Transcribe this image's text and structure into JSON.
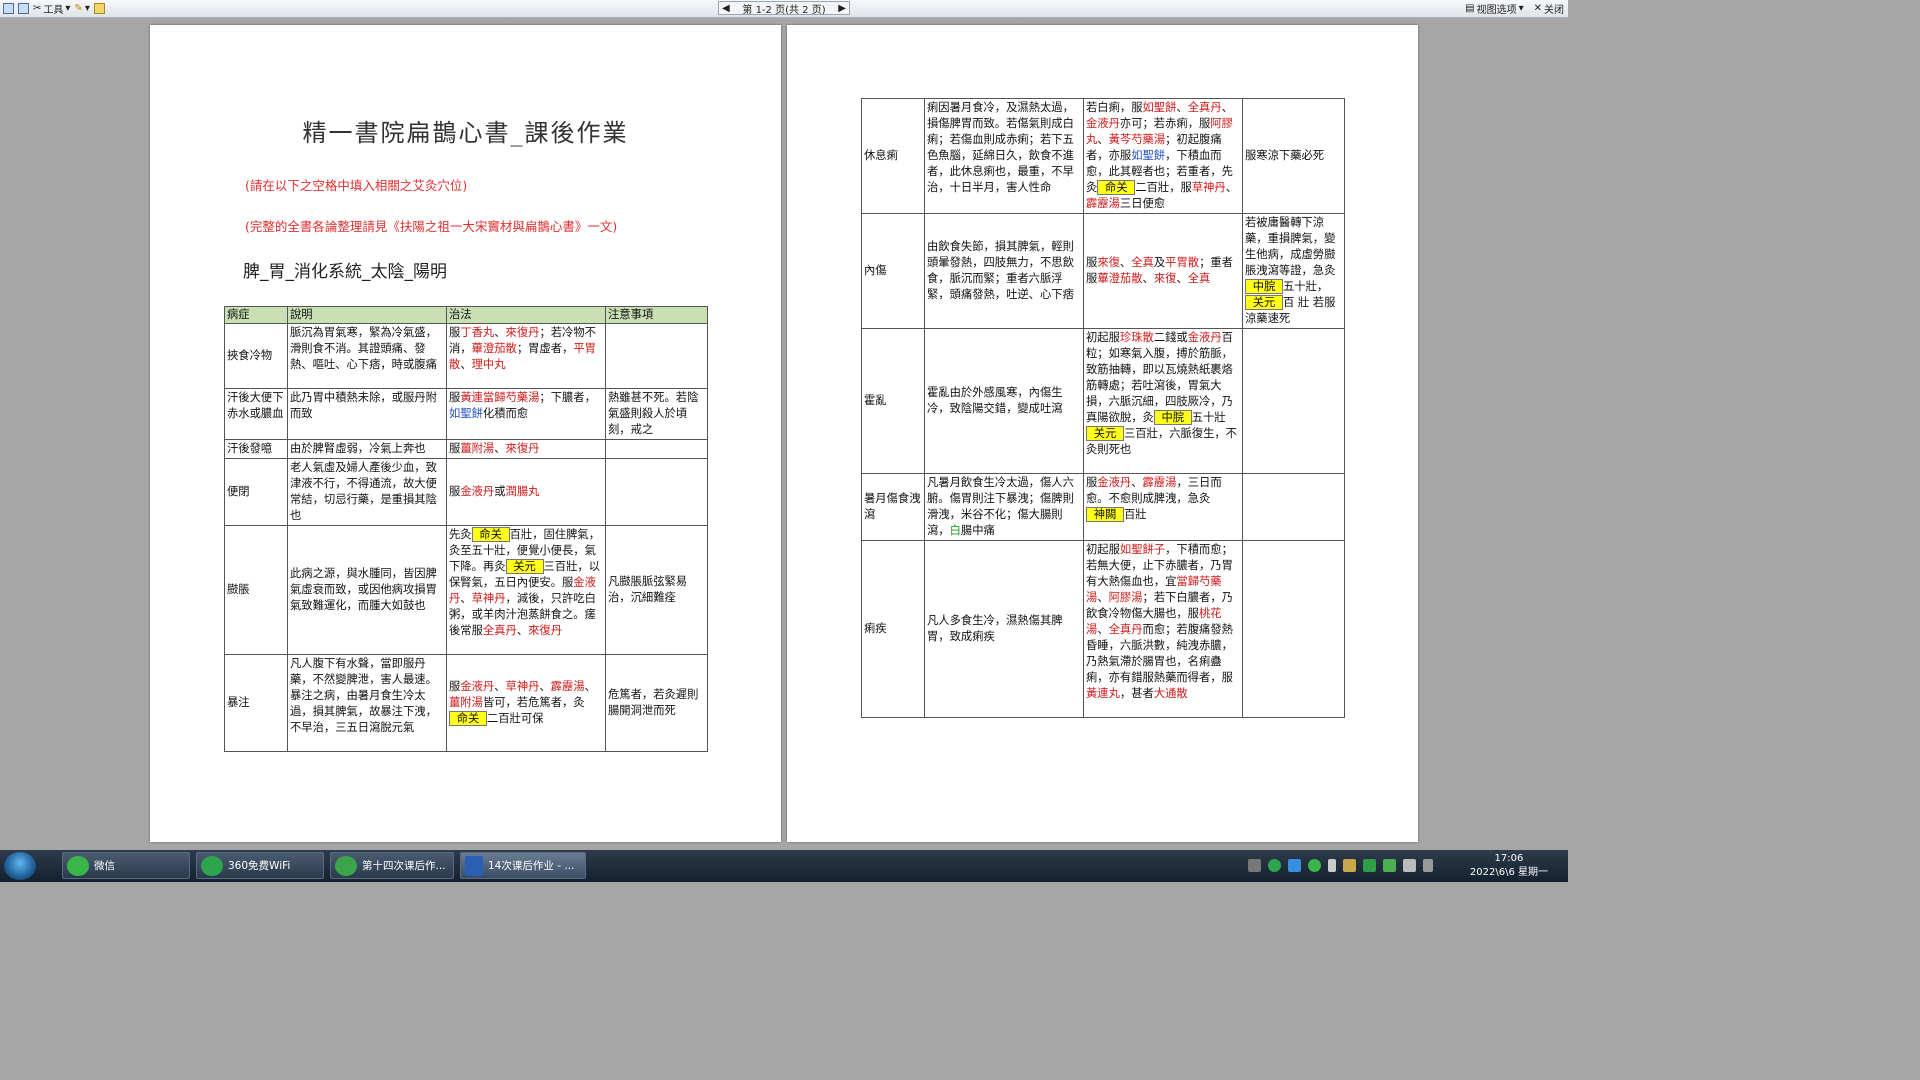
{
  "toolbar": {
    "tools_label": "工具",
    "page_indicator": "第 1-2 页(共 2 页)",
    "view_options_label": "视图选项",
    "close_label": "关闭"
  },
  "page1": {
    "title": "精一書院扁鵲心書_課後作業",
    "note1": "(請在以下之空格中填入相關之艾灸穴位)",
    "note2": "(完整的全書各論整理請見《扶陽之祖一大宋竇材與扁鵲心書》一文)",
    "heading": "脾_胃_消化系統_太陰_陽明",
    "columns": [
      "病症",
      "說明",
      "治法",
      "注意事項"
    ]
  },
  "rows1": [
    {
      "disease": "挾食冷物",
      "desc": "脈沉為胃氣寒，緊為冷氣盛，滑則食不消。其證頭痛、發熱、嘔吐、心下痞，時或腹痛",
      "note": ""
    },
    {
      "disease": "汗後大便下赤水或膿血",
      "desc": "此乃胃中積熱未除，或服丹附而致",
      "note": "熱雖甚不死。若陰氣盛則殺人於頃刻，戒之"
    },
    {
      "disease": "汗後發噫",
      "desc": "由於脾腎虛弱，冷氣上奔也",
      "note": ""
    },
    {
      "disease": "便閉",
      "desc": "老人氣虛及婦人產後少血，致津液不行，不得通流，故大便常結，切忌行藥，是重損其陰也",
      "note": ""
    },
    {
      "disease": "臌脹",
      "desc": "此病之源，與水腫同，皆因脾氣虛衰而致，或因他病攻損胃氣致難運化，而腫大如鼓也",
      "note": "凡臌脹脈弦緊易治，沉細難痊"
    },
    {
      "disease": "暴注",
      "desc": "凡人腹下有水聲，當即服丹藥，不然變脾泄，害人最速。暴注之病，由暑月食生冷太過，損其脾氣，故暴注下洩，不早治，三五日瀉脫元氣",
      "note": "危篤者，若灸遲則腸開洞泄而死"
    }
  ],
  "tx": {
    "r1": [
      "服",
      "丁香丸",
      "、",
      "來復丹",
      "；若冷物不消，",
      "蓽澄茄散",
      "；胃虛者，",
      "平胃散",
      "、",
      "理中丸"
    ],
    "r2": [
      "服",
      "黃連當歸芍藥湯",
      "；下膿者，",
      "如聖餅",
      "化積而愈"
    ],
    "r3": [
      "服",
      "薑附湯",
      "、",
      "來復丹"
    ],
    "r4": [
      "服",
      "金液丹",
      "或",
      "潤腸丸"
    ],
    "r5": [
      "先灸",
      "命关",
      "百壯，固住脾氣，灸至五十壯，便覺小便長，氣下降。再灸",
      "关元",
      "三百壯，以保腎氣，五日內便安。服",
      "金液丹",
      "、",
      "草神丹",
      "，減後，只許吃白粥，或羊肉汁泡蒸餅食之。瘥後常服",
      "全真丹",
      "、",
      "來復丹"
    ],
    "r6": [
      "服",
      "金液丹",
      "、",
      "草神丹",
      "、",
      "霹靂湯",
      "、",
      "薑附湯",
      "皆可，若危篤者，灸",
      "命关",
      "二百壯可保"
    ]
  },
  "rows2": [
    {
      "disease": "休息痢",
      "desc": "痢因暑月食冷，及濕熱太過，損傷脾胃而致。若傷氣則成白痢；若傷血則成赤痢；若下五色魚腦，延綿日久，飲食不進者，此休息痢也，最重，不早治，十日半月，害人性命",
      "note": "服寒涼下藥必死"
    },
    {
      "disease": "內傷",
      "desc": "由飲食失節，損其脾氣，輕則頭暈發熱，四肢無力，不思飲食，脈沉而緊；重者六脈浮緊，頭痛發熱，吐逆、心下痞",
      "note": ""
    },
    {
      "disease": "霍亂",
      "desc": "霍亂由於外感風寒，內傷生冷，致陰陽交錯，變成吐瀉",
      "note": ""
    },
    {
      "disease": "暑月傷食洩瀉",
      "desc": "凡暑月飲食生冷太過，傷人六腑。傷胃則注下暴洩；傷脾則滑洩，米谷不化；傷大腸則瀉，",
      "desc_green": "白",
      "desc_tail": "腸中痛",
      "note": ""
    },
    {
      "disease": "痢疾",
      "desc": "凡人多食生冷，濕熱傷其脾胃，致成痢疾",
      "note": ""
    }
  ],
  "tx2": {
    "r1": [
      "若白痢，服",
      "如聖餅",
      "、",
      "全真丹",
      "、",
      "金液丹",
      "亦可；若赤痢，服",
      "阿膠丸",
      "、",
      "黃芩芍藥湯",
      "；初起腹痛者，亦服",
      "如聖餅",
      "，下積血而愈，此其輕者也；若重者，先灸",
      "命关",
      "二百壯，服",
      "草神丹",
      "、",
      "霹靂湯",
      "三日便愈"
    ],
    "r2": [
      "服",
      "來復",
      "、",
      "全真",
      "及",
      "平胃散",
      "；重者服",
      "蓽澄茄散",
      "、",
      "來復",
      "、",
      "全真"
    ],
    "r2n": [
      "若被庸醫轉下涼藥，重損脾氣，變生他病，成虛勞臌脹洩瀉等證，急灸",
      "中脘",
      "五十壯，",
      "关元",
      "百 壯 若服涼藥速死"
    ],
    "r3": [
      "初起服",
      "珍珠散",
      "二錢或",
      "金液丹",
      "百粒；如寒氣入腹，搏於筋脈，致筋抽轉，即以瓦燒熱紙裹烙筋轉處；若吐瀉後，胃氣大損，六脈沉細，四肢厥冷，乃真陽欲脫，灸",
      "中脘",
      "五十壯",
      "关元",
      "三百壯，六脈復生，不灸則死也"
    ],
    "r4": [
      "服",
      "金液丹",
      "、",
      "霹靂湯",
      "，三日而愈。不愈則成脾洩，急灸",
      "神闕",
      "百壯"
    ],
    "r5": [
      "初起服",
      "如聖餅子",
      "，下積而愈；若無大便，止下赤膿者，乃胃有大熱傷血也，宜",
      "當歸芍藥湯",
      "、",
      "阿膠湯",
      "；若下白膿者，乃飲食冷物傷大腸也，服",
      "桃花湯",
      "、",
      "全真丹",
      "而愈；若腹痛發熱昏睡，六脈洪數，純洩赤膿，乃熱氣滯於腸胃也，名痢蠱痢，亦有錯服熱藥而得者，服",
      "黃連丸",
      "，甚者",
      "大通散"
    ]
  },
  "taskbar": {
    "items": [
      "微信",
      "360免费WiFi",
      "第十四次课后作...",
      "14次课后作业 - ..."
    ],
    "time": "17:06",
    "date": "2022\\6\\6 星期一"
  },
  "colors": {
    "remedy": "#d11a1a",
    "remedy_alt": "#1f4fc7",
    "acupoint_highlight": "#ffff1a",
    "header_bg": "#c8e0b4"
  },
  "icons": [
    "save-icon",
    "print-icon",
    "tools-icon",
    "highlight-icon",
    "folder-icon",
    "page-prev-icon",
    "page-next-icon",
    "view-options-icon",
    "close-icon",
    "start-orb-icon",
    "wechat-icon",
    "wifi-icon",
    "app360-icon",
    "word-icon"
  ]
}
